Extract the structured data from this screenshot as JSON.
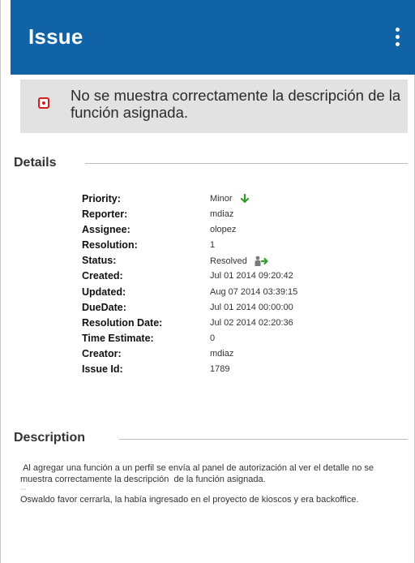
{
  "appbar": {
    "title": "Issue",
    "icon": "more-vert-icon",
    "color": "#0f63a6"
  },
  "issue": {
    "summary": "No se muestra correctamente la descripción de la función asignada.",
    "status_icon": "record-icon",
    "status_icon_color": "#d51e1e"
  },
  "details": {
    "heading": "Details",
    "fields": [
      {
        "label": "Priority:",
        "value": "Minor",
        "icon": "arrow-down-icon"
      },
      {
        "label": "Reporter:",
        "value": "mdiaz"
      },
      {
        "label": "Assignee:",
        "value": "olopez"
      },
      {
        "label": "Resolution:",
        "value": "1"
      },
      {
        "label": "Status:",
        "value": "Resolved",
        "icon": "resolved-icon"
      },
      {
        "label": "Created:",
        "value": "Jul 01 2014 09:20:42"
      },
      {
        "label": "Updated:",
        "value": "Aug 07 2014 03:39:15"
      },
      {
        "label": "DueDate:",
        "value": "Jul 01 2014 00:00:00"
      },
      {
        "label": "Resolution Date:",
        "value": "Jul 02 2014 02:20:36"
      },
      {
        "label": "Time Estimate:",
        "value": "0"
      },
      {
        "label": "Creator:",
        "value": "mdiaz"
      },
      {
        "label": "Issue Id:",
        "value": "1789"
      }
    ]
  },
  "description": {
    "heading": "Description",
    "paragraph_1": " Al agregar una función a un perfil se envía al panel de autorización al ver el detalle no se muestra correctamente la descripción  de la función asignada.",
    "separator": "--",
    "paragraph_2": "Oswaldo favor cerrarla, la había ingresado en el proyecto de kioscos y era backoffice."
  }
}
